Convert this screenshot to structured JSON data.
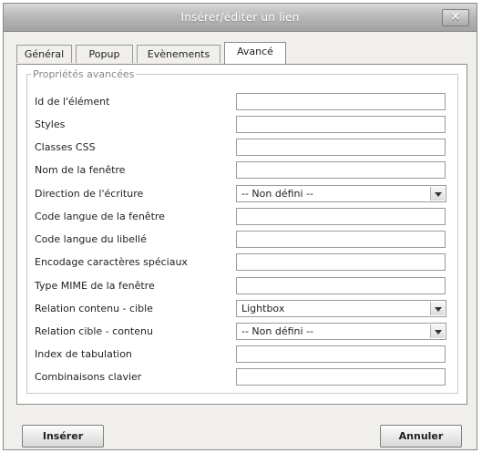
{
  "window": {
    "title": "Insérer/éditer un lien",
    "close_glyph": "×"
  },
  "tabs": [
    {
      "label": "Général"
    },
    {
      "label": "Popup"
    },
    {
      "label": "Evènements"
    },
    {
      "label": "Avancé",
      "active": true
    }
  ],
  "fieldset": {
    "legend": "Propriétés avancées",
    "fields": [
      {
        "label": "Id de l'élément",
        "type": "text",
        "value": ""
      },
      {
        "label": "Styles",
        "type": "text",
        "value": ""
      },
      {
        "label": "Classes CSS",
        "type": "text",
        "value": ""
      },
      {
        "label": "Nom de la fenêtre",
        "type": "text",
        "value": ""
      },
      {
        "label": "Direction de l'écriture",
        "type": "select",
        "value": "-- Non défini --"
      },
      {
        "label": "Code langue de la fenêtre",
        "type": "text",
        "value": ""
      },
      {
        "label": "Code langue du libellé",
        "type": "text",
        "value": ""
      },
      {
        "label": "Encodage caractères spéciaux",
        "type": "text",
        "value": ""
      },
      {
        "label": "Type MIME de la fenêtre",
        "type": "text",
        "value": ""
      },
      {
        "label": "Relation contenu - cible",
        "type": "select",
        "value": "Lightbox"
      },
      {
        "label": "Relation cible - contenu",
        "type": "select",
        "value": "-- Non défini --"
      },
      {
        "label": "Index de tabulation",
        "type": "text",
        "value": ""
      },
      {
        "label": "Combinaisons clavier",
        "type": "text",
        "value": ""
      }
    ]
  },
  "buttons": {
    "insert": "Insérer",
    "cancel": "Annuler"
  },
  "icons": {
    "close": "close-icon",
    "dropdown": "chevron-down-icon"
  }
}
